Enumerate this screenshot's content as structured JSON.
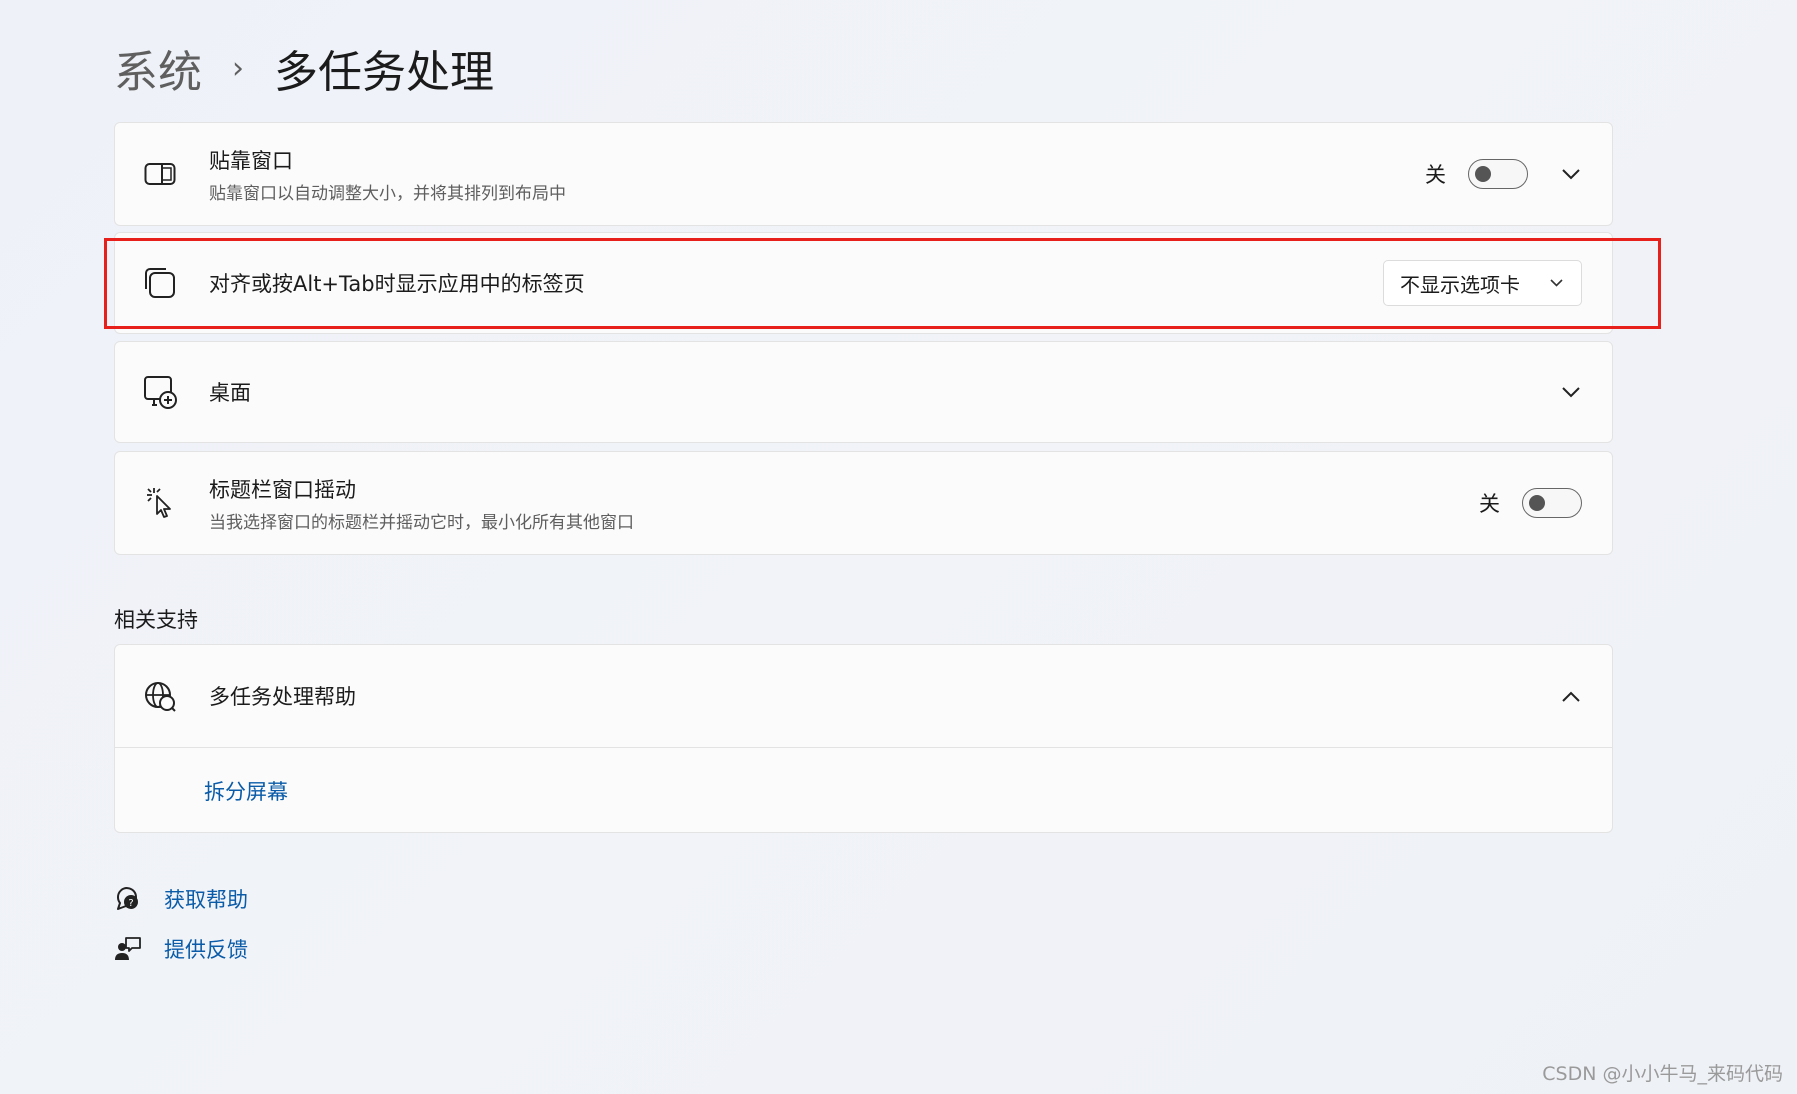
{
  "breadcrumb": {
    "parent": "系统",
    "separator": "›",
    "current": "多任务处理"
  },
  "snap": {
    "title": "贴靠窗口",
    "subtitle": "贴靠窗口以自动调整大小，并将其排列到布局中",
    "toggle_label": "关",
    "icon": "snap-window-icon"
  },
  "alt_tab": {
    "title": "对齐或按Alt+Tab时显示应用中的标签页",
    "dropdown_value": "不显示选项卡",
    "icon": "tabs-icon"
  },
  "desktops": {
    "title": "桌面",
    "icon": "add-desktop-icon"
  },
  "shake": {
    "title": "标题栏窗口摇动",
    "subtitle": "当我选择窗口的标题栏并摇动它时，最小化所有其他窗口",
    "toggle_label": "关",
    "icon": "shake-cursor-icon"
  },
  "related": {
    "heading": "相关支持",
    "help_title": "多任务处理帮助",
    "help_link": "拆分屏幕"
  },
  "footer": {
    "get_help": "获取帮助",
    "feedback": "提供反馈"
  },
  "watermark": "CSDN @小小牛马_来码代码",
  "colors": {
    "highlight": "#e8201c",
    "link": "#0a5ba8"
  }
}
